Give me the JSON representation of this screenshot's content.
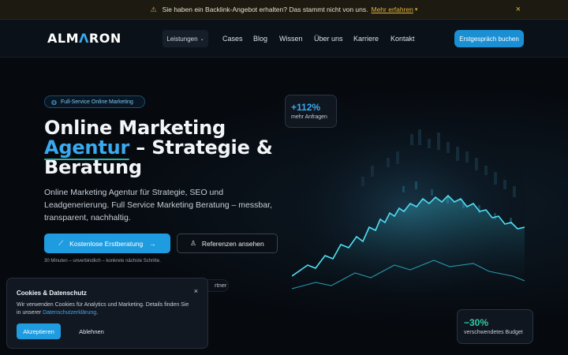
{
  "banner": {
    "message": "Sie haben ein Backlink-Angebot erhalten? Das stammt nicht von uns.",
    "link": "Mehr erfahren",
    "close": "×"
  },
  "header": {
    "logo_left": "ALM",
    "logo_mark": "Λ",
    "logo_right": "RON",
    "services_label": "Leistungen",
    "nav": [
      "Cases",
      "Blog",
      "Wissen",
      "Über uns",
      "Karriere",
      "Kontakt"
    ],
    "cta": "Erstgespräch buchen"
  },
  "hero": {
    "badge": "Full-Service Online Marketing",
    "headline_line1": "Online Marketing",
    "headline_accent": "Agentur",
    "headline_line2_rest": " – Strategie &",
    "headline_line3": "Beratung",
    "subline": "Online Marketing Agentur für Strategie, SEO und Leadgenerierung. Full Service Marketing Beratung – messbar, transparent, nachhaltig.",
    "primary_cta": "Kostenlose Erstberatung",
    "secondary_cta": "Referenzen ansehen",
    "note": "30 Minuten – unverbindlich – konkrete nächste Schritte.",
    "partner_tail": "rtner"
  },
  "stats": {
    "top": {
      "value": "+112%",
      "label": "mehr Anfragen"
    },
    "bottom": {
      "value": "−30%",
      "label": "verschwendetes Budget"
    }
  },
  "cookie": {
    "title": "Cookies & Datenschutz",
    "text": "Wir verwenden Cookies für Analytics und Marketing. Details finden Sie in unserer",
    "link": "Datenschutzerklärung",
    "text_end": ".",
    "accept": "Akzeptieren",
    "reject": "Ablehnen",
    "close": "×"
  },
  "colors": {
    "accent": "#1f9ce0",
    "warning": "#e0b43c",
    "green": "#30c8a6"
  }
}
